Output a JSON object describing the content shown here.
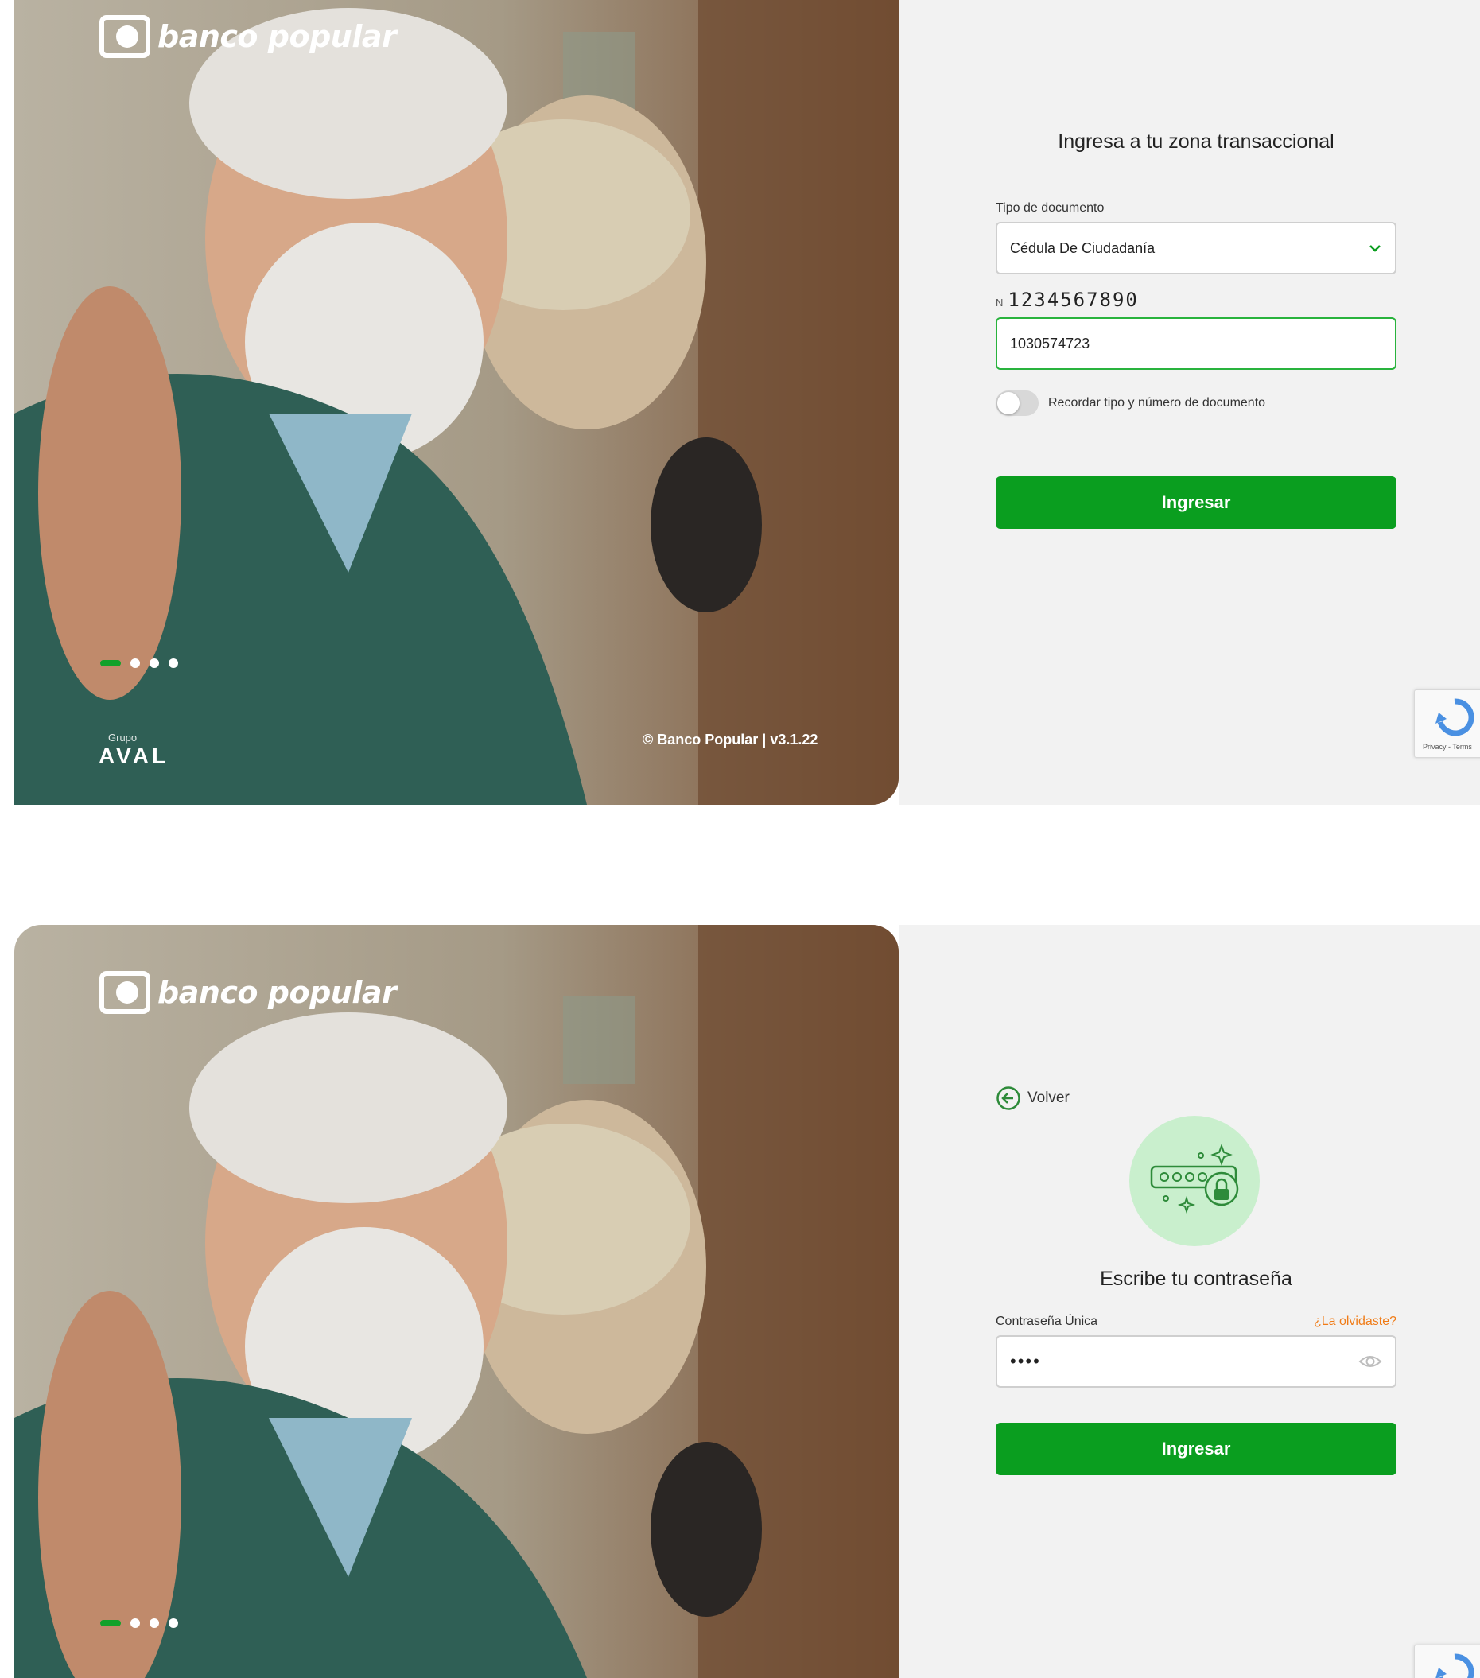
{
  "brand": {
    "name": "banco popular",
    "group_small": "Grupo",
    "group": "AVAL"
  },
  "footer": {
    "copyright": "© Banco Popular | v3.1.22"
  },
  "login": {
    "title": "Ingresa a tu zona transaccional",
    "doc_type_label": "Tipo de documento",
    "doc_type_value": "Cédula De Ciudadanía",
    "doc_number_label_prefix": "N",
    "doc_number_overlay": "1234567890",
    "doc_number_value": "1030574723",
    "remember_label": "Recordar tipo y número de documento",
    "submit_label": "Ingresar"
  },
  "password": {
    "back_label": "Volver",
    "title": "Escribe tu contraseña",
    "field_label": "Contraseña Única",
    "forgot_label": "¿La olvidaste?",
    "field_value": "••••",
    "submit_label": "Ingresar"
  },
  "recaptcha": {
    "links": "Privacy - Terms"
  },
  "carousel": {
    "slide_count": 4,
    "active_index": 0
  },
  "colors": {
    "primary": "#0a9e1f",
    "focus_border": "#29b33d",
    "link_orange": "#f07b16",
    "panel_bg": "#f2f2f2"
  },
  "icons": [
    "banco-popular-logo-icon",
    "chevron-down-icon",
    "arrow-left-circle-icon",
    "password-lock-illustration-icon",
    "eye-icon",
    "recaptcha-icon"
  ]
}
